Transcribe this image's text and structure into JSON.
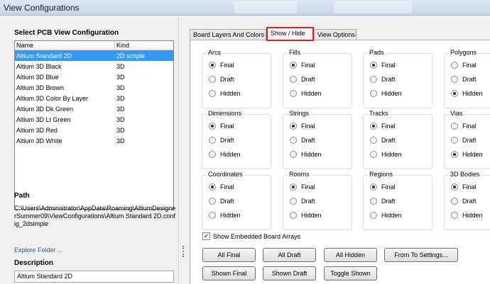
{
  "window": {
    "title": "View Configurations"
  },
  "left": {
    "select_title": "Select PCB View Configuration",
    "table": {
      "headers": [
        "Name",
        "Kind"
      ],
      "rows": [
        [
          "Altium Standard 2D",
          "2D simple"
        ],
        [
          "Altium 3D Black",
          "3D"
        ],
        [
          "Altium 3D Blue",
          "3D"
        ],
        [
          "Altium 3D Brown",
          "3D"
        ],
        [
          "Altium 3D Color By Layer",
          "3D"
        ],
        [
          "Altium 3D Dk Green",
          "3D"
        ],
        [
          "Altium 3D Lt Green",
          "3D"
        ],
        [
          "Altium 3D Red",
          "3D"
        ],
        [
          "Altium 3D White",
          "3D"
        ]
      ]
    },
    "path_title": "Path",
    "path_value": "C:\\Users\\Administrator\\AppData\\Roaming\\AltiumDesignerSummer09\\ViewConfigurations\\Altium Standard 2D.config_2dsimple",
    "explore_link": "Explore Folder ...",
    "description_title": "Description",
    "description_value": "Altium Standard 2D"
  },
  "tabs": [
    "Board Layers And Colors",
    "Show / Hide",
    "View Options"
  ],
  "active_tab": "Show / Hide",
  "option_labels": [
    "Final",
    "Draft",
    "Hidden"
  ],
  "groups": [
    {
      "title": "Arcs",
      "selected": "Final"
    },
    {
      "title": "Fills",
      "selected": "Final"
    },
    {
      "title": "Pads",
      "selected": "Final"
    },
    {
      "title": "Polygons",
      "selected": "Hidden"
    },
    {
      "title": "Dimensions",
      "selected": "Final"
    },
    {
      "title": "Strings",
      "selected": "Final"
    },
    {
      "title": "Tracks",
      "selected": "Final"
    },
    {
      "title": "Vias",
      "selected": "Hidden"
    },
    {
      "title": "Coordinates",
      "selected": "Final"
    },
    {
      "title": "Rooms",
      "selected": "Final"
    },
    {
      "title": "Regions",
      "selected": "Final"
    },
    {
      "title": "3D Bodies",
      "selected": "Final"
    }
  ],
  "show_embedded": {
    "label": "Show Embedded Board Arrays",
    "checked": true
  },
  "buttons": {
    "all_final": "All Final",
    "all_draft": "All Draft",
    "all_hidden": "All Hidden",
    "from_to": "From To Settings...",
    "shown_final": "Shown Final",
    "shown_draft": "Shown Draft",
    "toggle_shown": "Toggle Shown"
  },
  "colors": {
    "selection": "#3399ff",
    "highlight": "#e02020",
    "link": "#1a5fb4"
  }
}
